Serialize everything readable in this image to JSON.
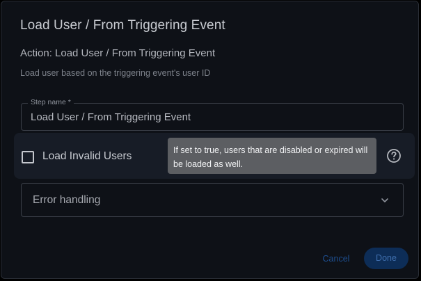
{
  "dialog": {
    "title": "Load User / From Triggering Event",
    "subtitle": "Action: Load User / From Triggering Event",
    "description": "Load user based on the triggering event's user ID"
  },
  "step_name": {
    "label": "Step name *",
    "value": "Load User / From Triggering Event"
  },
  "load_invalid_users": {
    "label": "Load Invalid Users",
    "checked": false,
    "tooltip": "If set to true, users that are disabled or expired will be loaded as well.",
    "help_icon": "help-circle-icon"
  },
  "error_handling": {
    "label": "Error handling",
    "icon": "chevron-down-icon",
    "expanded": false
  },
  "footer": {
    "cancel_label": "Cancel",
    "done_label": "Done"
  },
  "colors": {
    "background": "#0e1117",
    "checkbox_row": "#171c26",
    "tooltip": "#5c5e62",
    "accent": "#1e4f91",
    "done_button": "#0d2d57"
  }
}
